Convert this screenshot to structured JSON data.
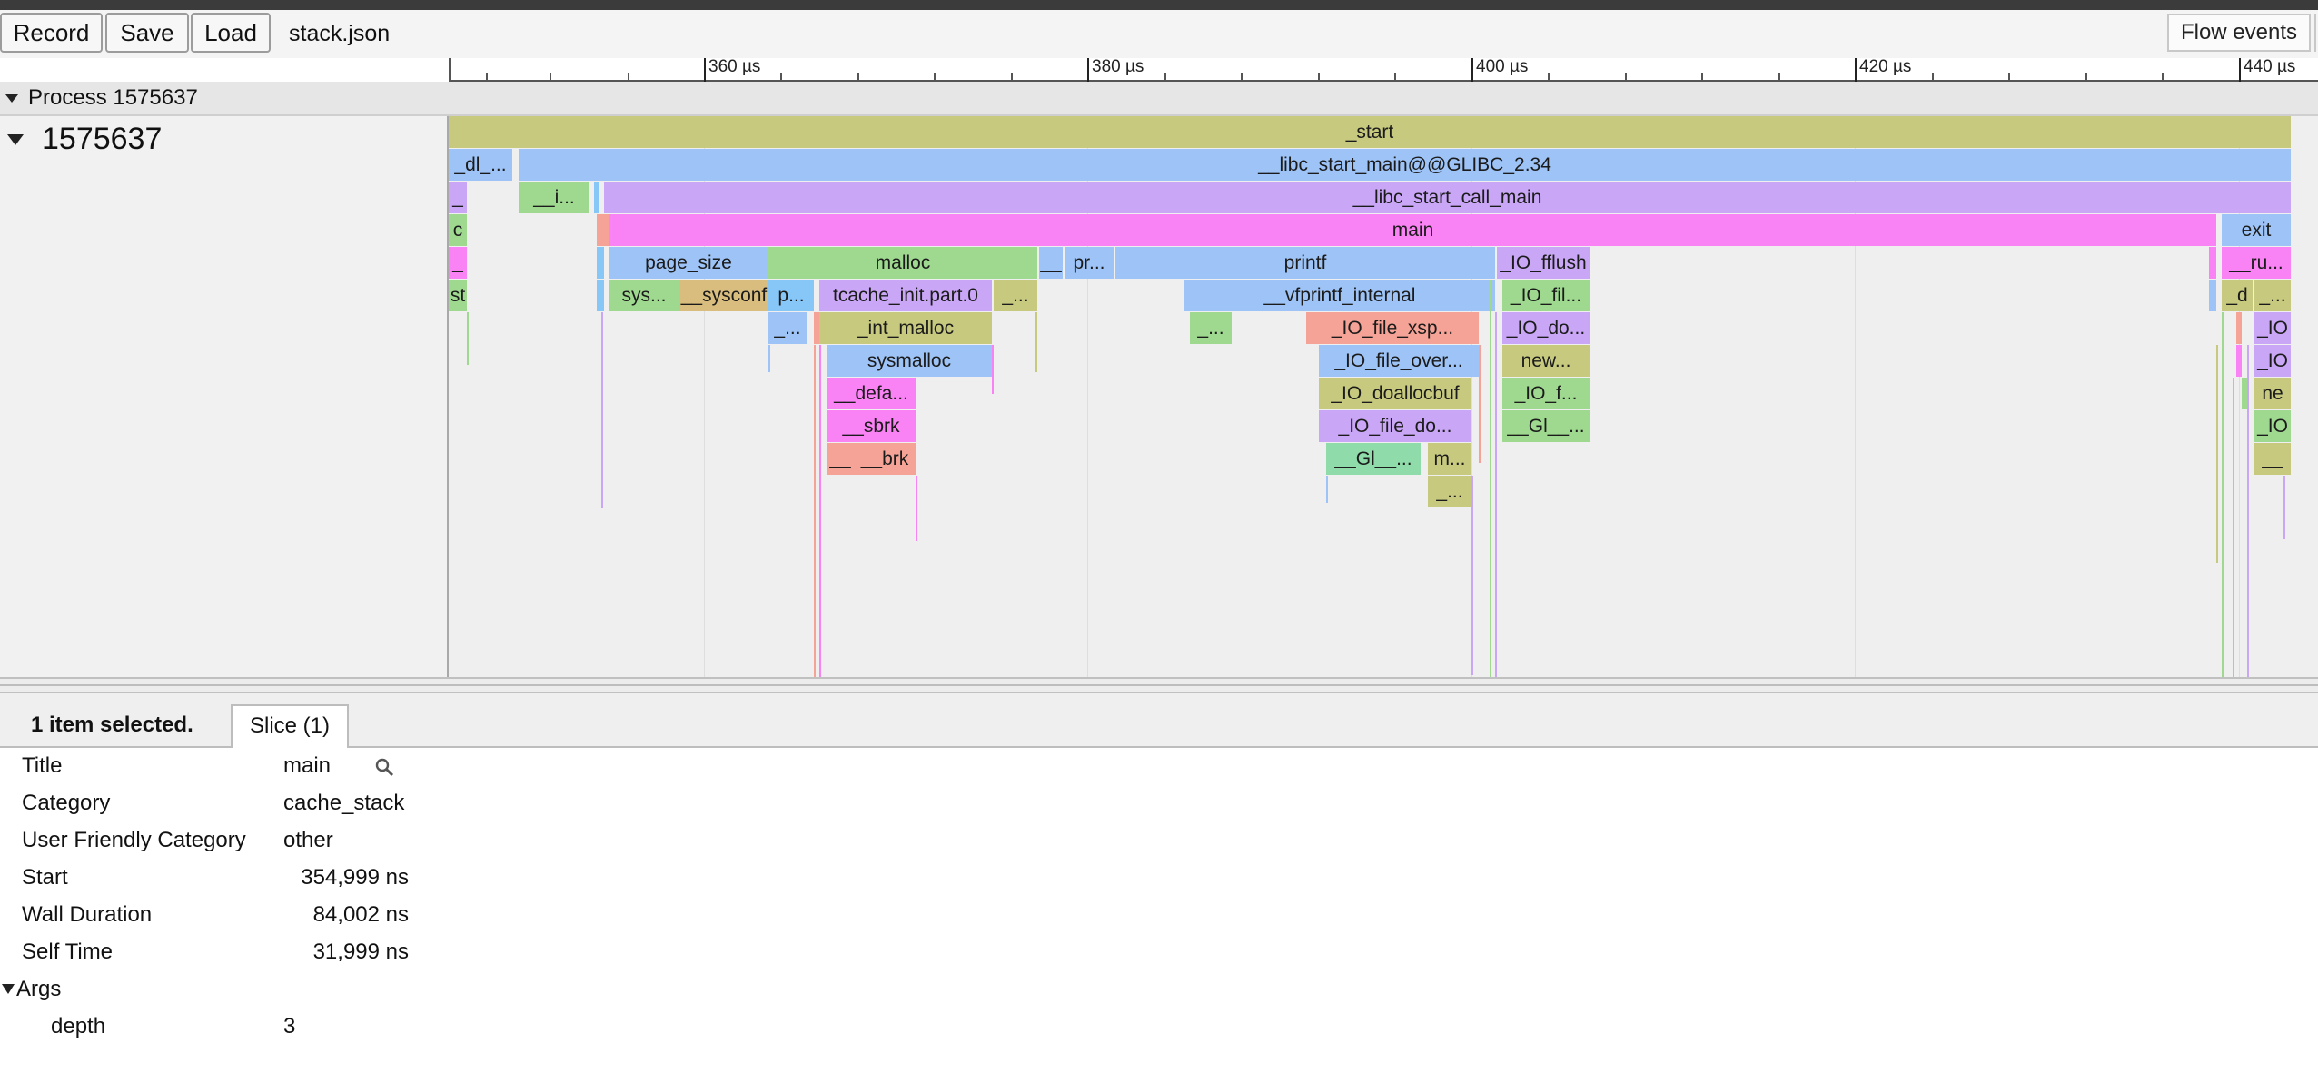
{
  "toolbar": {
    "record_label": "Record",
    "save_label": "Save",
    "load_label": "Load",
    "filename": "stack.json",
    "flow_events_label": "Flow events"
  },
  "ruler": {
    "ticks": [
      "360 µs",
      "380 µs",
      "400 µs",
      "420 µs",
      "440 µs"
    ]
  },
  "process": {
    "header_label": "Process 1575637",
    "thread_label": "1575637"
  },
  "slices": {
    "start": "_start",
    "dl": "_dl_...",
    "libc_start_main": "__libc_start_main@@GLIBC_2.34",
    "u1": "_",
    "i": "__i...",
    "libc_start_call_main": "__libc_start_call_main",
    "c": "c",
    "main": "main",
    "exit": "exit",
    "u2": "_",
    "page_size": "page_size",
    "malloc": "malloc",
    "dunder": "__",
    "pr": "pr...",
    "printf": "printf",
    "io_fflush": "_IO_fflush",
    "ru": "__ru...",
    "st": "st",
    "sys": "sys...",
    "sysconf": "__sysconf",
    "p": "p...",
    "tcache_init": "tcache_init.part.0",
    "under_dots1": "_...",
    "vfprintf": "__vfprintf_internal",
    "io_fil": "_IO_fil...",
    "d": "_d",
    "under_dots2": "_...",
    "under_dots3": "_...",
    "int_malloc": "_int_malloc",
    "under_dots4": "_...",
    "io_file_xsp": "_IO_file_xsp...",
    "io_do": "_IO_do...",
    "io_r1": "_IO",
    "sysmalloc": "sysmalloc",
    "io_file_over": "_IO_file_over...",
    "new": "new...",
    "io_r2": "_IO",
    "defa": "__defa...",
    "io_doallocbuf": "_IO_doallocbuf",
    "io_f": "_IO_f...",
    "ne": "ne",
    "sbrk": "__sbrk",
    "io_file_do": "_IO_file_do...",
    "gl1": "__Gl__...",
    "io_r3": "_IO",
    "dunder2": "__",
    "brk": "__brk",
    "gl2": "__Gl__...",
    "m": "m...",
    "under": "__",
    "under_dots5": "_..."
  },
  "colors": {
    "olive": "#c6c97e",
    "blue": "#9ec4f7",
    "purple": "#c9a7f6",
    "pink": "#f982f4",
    "green": "#9ed98f",
    "tan": "#d9bd7e",
    "salmon": "#f5a396",
    "lightblue": "#86c7f7",
    "teal": "#8fdcaa"
  },
  "details": {
    "selected_count": "1 item selected.",
    "tab_label": "Slice (1)",
    "title_label": "Title",
    "title_value": "main",
    "category_label": "Category",
    "category_value": "cache_stack",
    "ufc_label": "User Friendly Category",
    "ufc_value": "other",
    "start_label": "Start",
    "start_value": "354,999 ns",
    "wall_label": "Wall Duration",
    "wall_value": "84,002 ns",
    "self_label": "Self Time",
    "self_value": "31,999 ns",
    "args_label": "Args",
    "depth_label": "depth",
    "depth_value": "3"
  }
}
